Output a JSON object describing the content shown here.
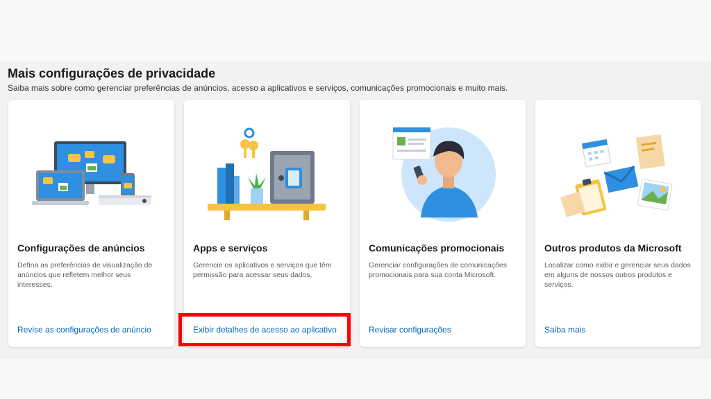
{
  "section": {
    "heading": "Mais configurações de privacidade",
    "subheading": "Saiba mais sobre como gerenciar preferências de anúncios, acesso a aplicativos e serviços, comunicações promocionais e muito mais."
  },
  "cards": [
    {
      "title": "Configurações de anúncios",
      "description": "Defina as preferências de visualização de anúncios que refletem melhor seus interesses.",
      "link": "Revise as configurações de anúncio",
      "illustration": "devices-ads-illustration"
    },
    {
      "title": "Apps e serviços",
      "description": "Gerencie os aplicativos e serviços que têm permissão para acessar seus dados.",
      "link": "Exibir detalhes de acesso ao aplicativo",
      "illustration": "shelf-safe-keys-illustration",
      "highlighted": true
    },
    {
      "title": "Comunicações promocionais",
      "description": "Gerenciar configurações de comunicações promocionais para sua conta Microsoft.",
      "link": "Revisar configurações",
      "illustration": "person-phone-illustration"
    },
    {
      "title": "Outros produtos da Microsoft",
      "description": "Localizar como exibir e gerenciar seus dados em alguns de nossos outros produtos e serviços.",
      "link": "Saiba mais",
      "illustration": "office-items-illustration"
    }
  ],
  "colors": {
    "link": "#0067b8",
    "highlight": "#ff0000",
    "card_bg": "#ffffff",
    "page_bg": "#f2f2f2"
  }
}
